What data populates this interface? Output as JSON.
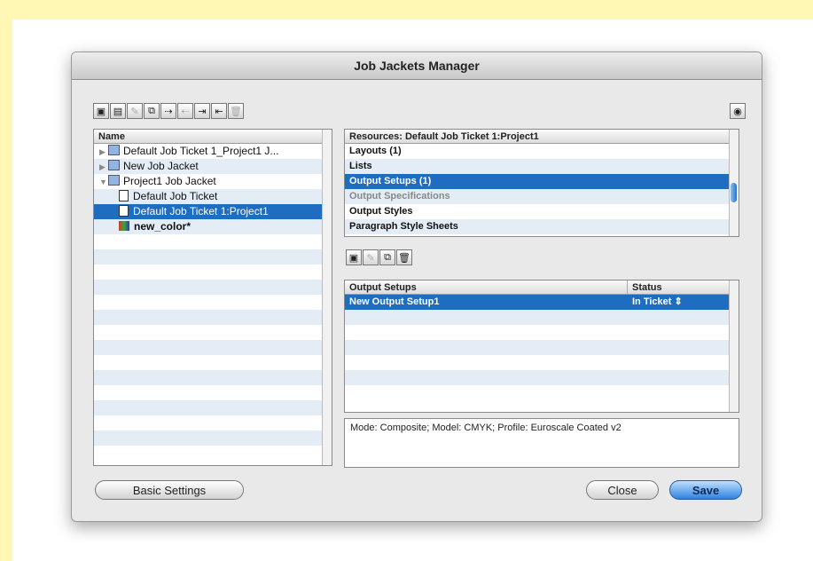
{
  "window": {
    "title": "Job Jackets Manager"
  },
  "left_toolbar": {
    "icons": [
      "new-job-jacket-icon",
      "new-job-ticket-icon",
      "edit-icon",
      "duplicate-icon",
      "link-icon",
      "unlink-icon",
      "import-icon",
      "export-icon",
      "delete-icon"
    ]
  },
  "tree": {
    "header": "Name",
    "items": [
      {
        "label": "Default Job Ticket 1_Project1 J...",
        "kind": "jacket",
        "expanded": false,
        "indent": 0
      },
      {
        "label": "New Job Jacket",
        "kind": "jacket",
        "expanded": false,
        "indent": 0
      },
      {
        "label": "Project1 Job Jacket",
        "kind": "jacket",
        "expanded": true,
        "indent": 0
      },
      {
        "label": "Default Job Ticket",
        "kind": "ticket",
        "indent": 1
      },
      {
        "label": "Default Job Ticket 1:Project1",
        "kind": "ticket",
        "indent": 1,
        "selected": true
      },
      {
        "label": "new_color*",
        "kind": "color",
        "indent": 1,
        "bold": true
      }
    ]
  },
  "resources": {
    "header": "Resources: Default Job Ticket 1:Project1",
    "items": [
      {
        "label": "Layouts (1)"
      },
      {
        "label": "Lists"
      },
      {
        "label": "Output Setups (1)",
        "selected": true
      },
      {
        "label": "Output Specifications",
        "muted": true
      },
      {
        "label": "Output Styles"
      },
      {
        "label": "Paragraph Style Sheets"
      }
    ]
  },
  "setups": {
    "col_name": "Output Setups",
    "col_status": "Status",
    "rows": [
      {
        "name": "New Output Setup1",
        "status": "In Ticket",
        "selected": true
      }
    ]
  },
  "description": "Mode: Composite; Model: CMYK; Profile: Euroscale Coated v2",
  "buttons": {
    "basic": "Basic Settings",
    "close": "Close",
    "save": "Save"
  }
}
